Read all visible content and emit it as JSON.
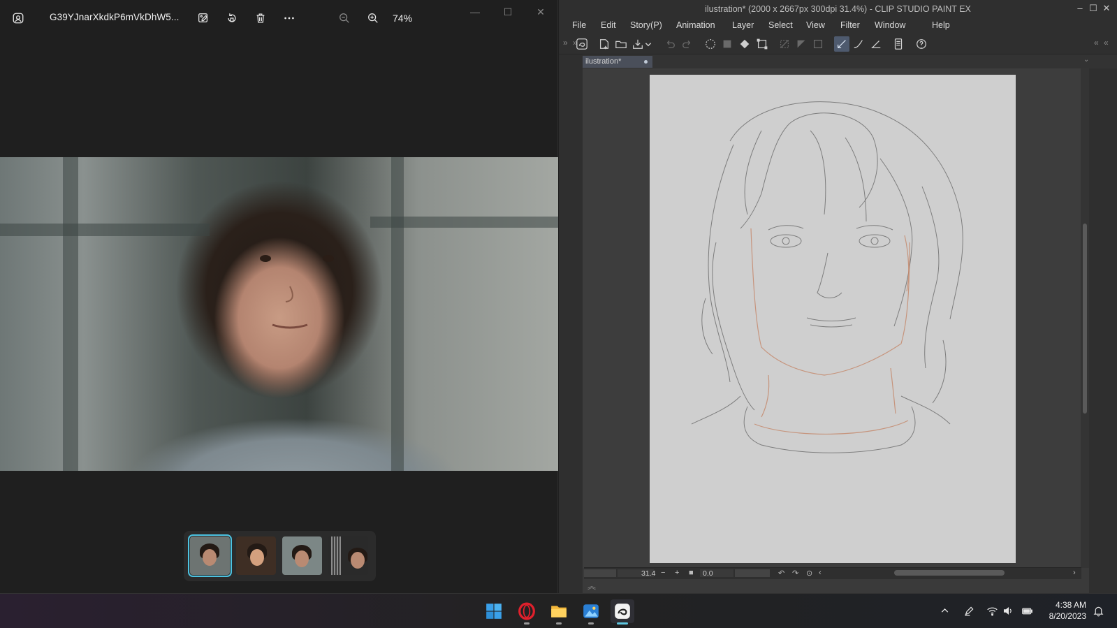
{
  "photos": {
    "filename": "G39YJnarXkdkP6mVkDhW5...",
    "zoom": "74%",
    "toolbar_icons": [
      "edit-icon",
      "rotate-icon",
      "delete-icon",
      "more-icon",
      "zoom-out-icon",
      "zoom-in-icon"
    ],
    "window_controls": [
      "minimize",
      "maximize",
      "close"
    ],
    "filmstrip_count": 4,
    "selected_thumb": 0
  },
  "csp": {
    "title": "ilustration* (2000 x 2667px 300dpi 31.4%)  - CLIP STUDIO PAINT EX",
    "menu": [
      "File",
      "Edit",
      "Story(P)",
      "Animation",
      "Layer",
      "Select",
      "View",
      "Filter",
      "Window",
      "Help"
    ],
    "doc_tab": "ilustration*",
    "zoom_value": "31.4",
    "rotation_value": "0.0"
  },
  "taskbar": {
    "apps": [
      "start",
      "opera",
      "file-explorer",
      "photos",
      "clip-studio"
    ],
    "active_app": "clip-studio",
    "time": "4:38 AM",
    "date": "8/20/2023"
  },
  "colors": {
    "accent": "#4cc2e0",
    "sketch_line": "#6f6f6f",
    "sketch_red": "#c58a6e",
    "paper": "#cfcfcf"
  }
}
